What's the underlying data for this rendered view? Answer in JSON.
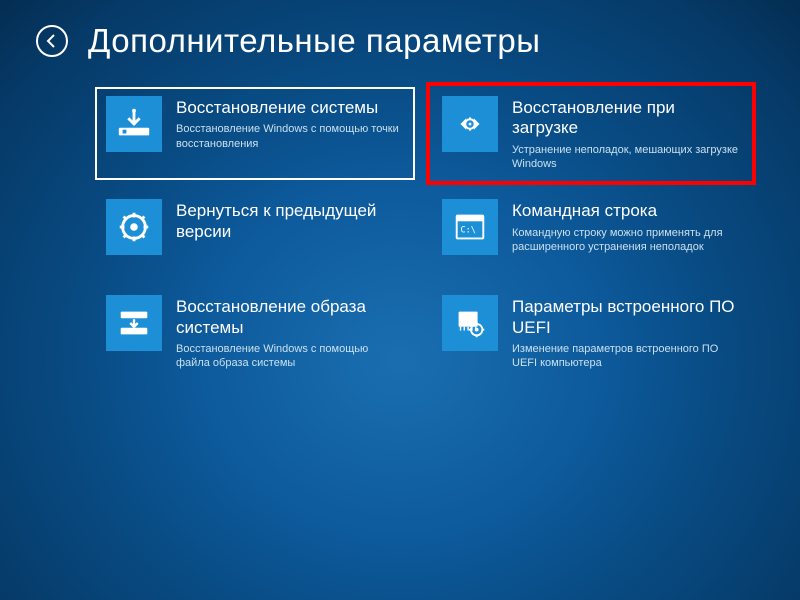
{
  "header": {
    "title": "Дополнительные параметры"
  },
  "tiles": [
    {
      "title": "Восстановление системы",
      "desc": "Восстановление Windows с помощью точки восстановления",
      "icon": "system-restore-icon",
      "selected": true,
      "highlighted": false
    },
    {
      "title": "Восстановление при загрузке",
      "desc": "Устранение неполадок, мешающих загрузке Windows",
      "icon": "startup-repair-icon",
      "selected": false,
      "highlighted": true
    },
    {
      "title": "Вернуться к предыдущей версии",
      "desc": "",
      "icon": "go-back-icon",
      "selected": false,
      "highlighted": false
    },
    {
      "title": "Командная строка",
      "desc": "Командную строку можно применять для расширенного устранения неполадок",
      "icon": "command-prompt-icon",
      "selected": false,
      "highlighted": false
    },
    {
      "title": "Восстановление образа системы",
      "desc": "Восстановление Windows с помощью файла образа системы",
      "icon": "image-recovery-icon",
      "selected": false,
      "highlighted": false
    },
    {
      "title": "Параметры встроенного ПО UEFI",
      "desc": "Изменение параметров встроенного ПО UEFI компьютера",
      "icon": "uefi-icon",
      "selected": false,
      "highlighted": false
    }
  ],
  "colors": {
    "tile": "#1d8fd6",
    "highlight": "#ff0000"
  }
}
